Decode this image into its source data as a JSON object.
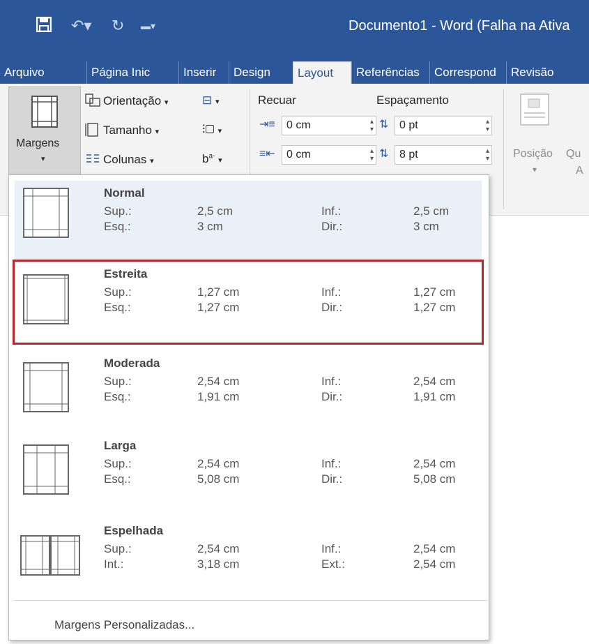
{
  "window": {
    "title": "Documento1 - Word (Falha na Ativa"
  },
  "qat": {
    "save": "save-icon",
    "undo": "undo-icon",
    "redo": "redo-icon",
    "customize": "qat-customize-icon"
  },
  "tabs": [
    "Arquivo",
    "Página Inic",
    "Inserir",
    "Design",
    "Layout",
    "Referências",
    "Correspond",
    "Revisão"
  ],
  "active_tab": "Layout",
  "ribbon": {
    "margens": "Margens",
    "orientacao": "Orientação",
    "tamanho": "Tamanho",
    "colunas": "Colunas",
    "recuar": "Recuar",
    "espacamento": "Espaçamento",
    "indent_left": "0 cm",
    "indent_right": "0 cm",
    "space_before": "0 pt",
    "space_after": "8 pt",
    "posicao": "Posição",
    "posicao_cut": "Qu",
    "posicao_a": "A"
  },
  "margin_options": [
    {
      "name": "Normal",
      "r1": [
        "Sup.:",
        "2,5 cm",
        "Inf.:",
        "2,5 cm"
      ],
      "r2": [
        "Esq.:",
        "3 cm",
        "Dir.:",
        "3 cm"
      ]
    },
    {
      "name": "Estreita",
      "r1": [
        "Sup.:",
        "1,27 cm",
        "Inf.:",
        "1,27 cm"
      ],
      "r2": [
        "Esq.:",
        "1,27 cm",
        "Dir.:",
        "1,27 cm"
      ]
    },
    {
      "name": "Moderada",
      "r1": [
        "Sup.:",
        "2,54 cm",
        "Inf.:",
        "2,54 cm"
      ],
      "r2": [
        "Esq.:",
        "1,91 cm",
        "Dir.:",
        "1,91 cm"
      ]
    },
    {
      "name": "Larga",
      "r1": [
        "Sup.:",
        "2,54 cm",
        "Inf.:",
        "2,54 cm"
      ],
      "r2": [
        "Esq.:",
        "5,08 cm",
        "Dir.:",
        "5,08 cm"
      ]
    },
    {
      "name": "Espelhada",
      "r1": [
        "Sup.:",
        "2,54 cm",
        "Inf.:",
        "2,54 cm"
      ],
      "r2": [
        "Int.:",
        "3,18 cm",
        "Ext.:",
        "2,54 cm"
      ]
    }
  ],
  "custom_margins": "Margens Personalizadas...",
  "colors": {
    "brand": "#2b579a",
    "highlight_border": "#b5252a",
    "selected_bg": "#eaf0f8"
  }
}
